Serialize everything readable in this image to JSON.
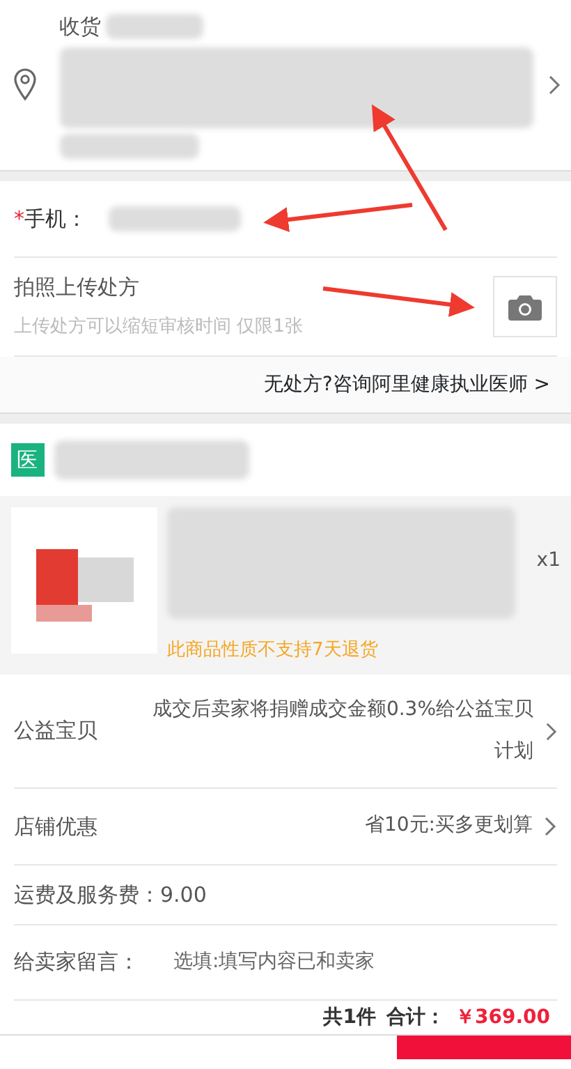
{
  "address": {
    "label": "收货"
  },
  "phone": {
    "required_mark": "*",
    "label": "手机："
  },
  "prescription": {
    "title": "拍照上传处方",
    "hint": "上传处方可以缩短审核时间 仅限1张"
  },
  "consult_link": "无处方?咨询阿里健康执业医师 >",
  "shop": {
    "badge": "医"
  },
  "product": {
    "quantity": "x1",
    "notice": "此商品性质不支持7天退货"
  },
  "options": [
    {
      "kind": "link",
      "label": "公益宝贝",
      "value": "成交后卖家将捐赠成交金额0.3%给公益宝贝计划"
    },
    {
      "kind": "link",
      "label": "店铺优惠",
      "value": "省10元:买多更划算"
    },
    {
      "kind": "text",
      "label": "运费及服务费：9.00"
    },
    {
      "kind": "input",
      "label": "给卖家留言：",
      "placeholder": "选填:填写内容已和卖家"
    }
  ],
  "footer": {
    "count": "共1件",
    "total_label": "合计：",
    "total": "￥369.00"
  }
}
